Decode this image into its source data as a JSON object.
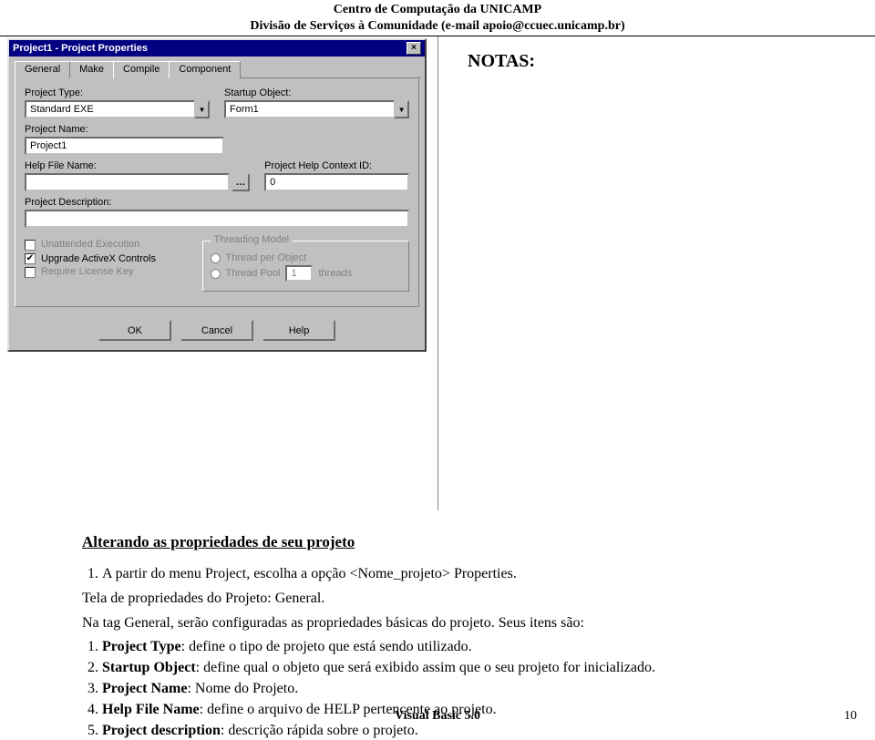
{
  "header": {
    "line1": "Centro de Computação da UNICAMP",
    "line2": "Divisão de Serviços à Comunidade (e-mail apoio@ccuec.unicamp.br)"
  },
  "notes_heading": "NOTAS:",
  "dialog": {
    "title": "Project1 - Project Properties",
    "tabs": [
      "General",
      "Make",
      "Compile",
      "Component"
    ],
    "labels": {
      "project_type": "Project Type:",
      "startup_object": "Startup Object:",
      "project_name": "Project Name:",
      "help_file": "Help File Name:",
      "context_id": "Project Help Context ID:",
      "project_desc": "Project Description:"
    },
    "values": {
      "project_type": "Standard EXE",
      "startup_object": "Form1",
      "project_name": "Project1",
      "help_file": "",
      "context_id": "0",
      "project_desc": ""
    },
    "checks": {
      "unattended": "Unattended Execution",
      "upgrade": "Upgrade ActiveX Controls",
      "license": "Require License Key"
    },
    "threading": {
      "legend": "Threading Model",
      "per_object": "Thread per Object",
      "pool": "Thread Pool",
      "pool_value": "1",
      "pool_suffix": "threads"
    },
    "buttons": {
      "ok": "OK",
      "cancel": "Cancel",
      "help": "Help"
    }
  },
  "article": {
    "title": "Alterando as propriedades de seu projeto",
    "step1": "A partir do menu Project, escolha a opção <Nome_projeto> Properties.",
    "caption": "Tela de propriedades do Projeto: General.",
    "intro": "Na tag General, serão configuradas as propriedades básicas do projeto. Seus itens são:",
    "items": [
      {
        "b": "Project Type",
        "t": ": define o tipo de projeto que está sendo utilizado."
      },
      {
        "b": "Startup Object",
        "t": ": define qual o objeto que será exibido assim que o seu projeto for inicializado."
      },
      {
        "b": "Project Name",
        "t": ": Nome do Projeto."
      },
      {
        "b": "Help File Name",
        "t": ": define o arquivo de HELP pertencente ao projeto."
      },
      {
        "b": "Project description",
        "t": ": descrição rápida sobre o projeto."
      }
    ]
  },
  "footer": {
    "center": "Visual Basic 5.0",
    "page": "10"
  }
}
